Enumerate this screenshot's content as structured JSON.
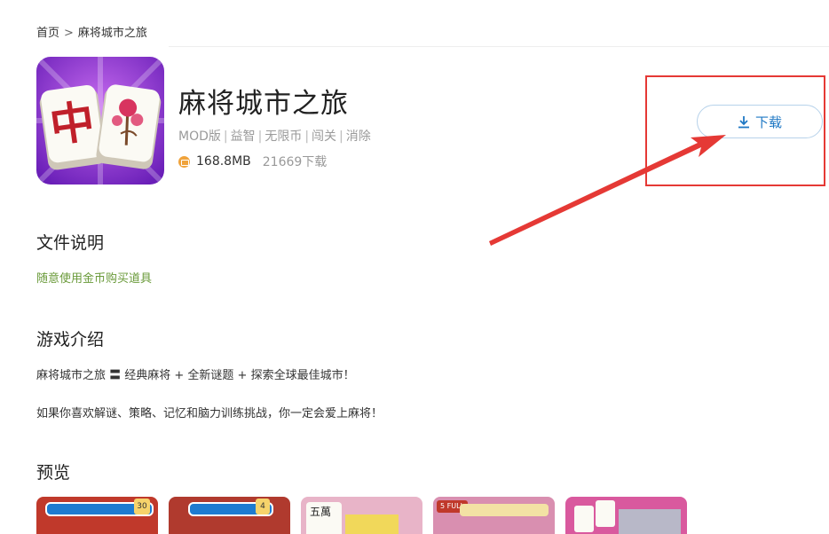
{
  "breadcrumb": {
    "home": "首页",
    "separator": ">",
    "current": "麻将城市之旅"
  },
  "app": {
    "title": "麻将城市之旅",
    "tags": [
      "MOD版",
      "益智",
      "无限币",
      "闯关",
      "消除"
    ],
    "tag_separator": "|",
    "size": "168.8MB",
    "downloads": "21669下载",
    "icon": "mahjong-tiles-icon",
    "icon_tile_chars": [
      "中"
    ]
  },
  "download_button": {
    "label": "下载",
    "icon": "download-icon",
    "color": "#1f78c4"
  },
  "annotation": {
    "color": "#e53935"
  },
  "sections": {
    "file_desc": {
      "title": "文件说明",
      "text": "随意使用金币购买道具",
      "color": "#6a9a3a"
    },
    "intro": {
      "title": "游戏介绍",
      "lines": [
        "麻将城市之旅 〓 经典麻将 + 全新谜题 + 探索全球最佳城市！",
        "如果你喜欢解谜、策略、记忆和脑力训练挑战，你一定会爱上麻将！"
      ]
    },
    "preview": {
      "title": "预览",
      "thumbnails": [
        {
          "name": "preview-1",
          "bg": "#c0392b",
          "label": "30"
        },
        {
          "name": "preview-2",
          "bg": "#b03a2e",
          "label": "4"
        },
        {
          "name": "preview-3",
          "bg": "#e8b4c8",
          "chars": "五萬"
        },
        {
          "name": "preview-4",
          "bg": "#d98fb0",
          "label": "5 FULL"
        },
        {
          "name": "preview-5",
          "bg": "#d9599e",
          "label": ""
        }
      ]
    }
  }
}
